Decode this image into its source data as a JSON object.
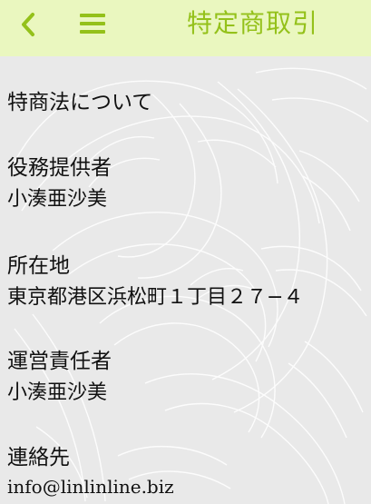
{
  "header": {
    "back_icon": "chevron-left-icon",
    "menu_icon": "hamburger-menu-icon",
    "title": "特定商取引",
    "background_color": "#eaf7bf",
    "accent_color": "#94c11a"
  },
  "content": {
    "intro": "特商法について",
    "provider_label": "役務提供者",
    "provider_name": "小湊亜沙美",
    "location_label": "所在地",
    "address": "東京都港区浜松町１丁目２７−４",
    "manager_label": "運営責任者",
    "manager_name": "小湊亜沙美",
    "contact_label": "連絡先",
    "email": "info@linlinline.biz"
  }
}
